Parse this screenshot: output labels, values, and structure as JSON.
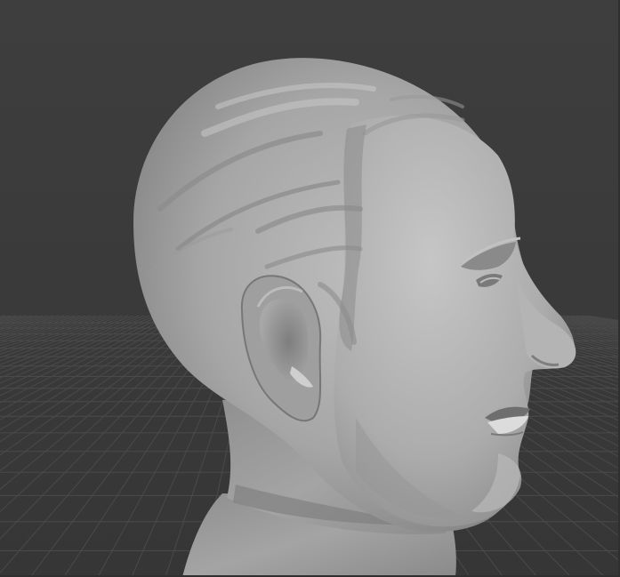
{
  "viewport": {
    "background_color": "#3d3d3d",
    "grid_color": "#4a4a4a",
    "sculpt_base_color": "#a9a9a9",
    "sculpt_shadow_color": "#6f6f6f",
    "sculpt_highlight_color": "#cfcfcf",
    "sculpt_object": "head-bust",
    "floor_grid": true
  }
}
